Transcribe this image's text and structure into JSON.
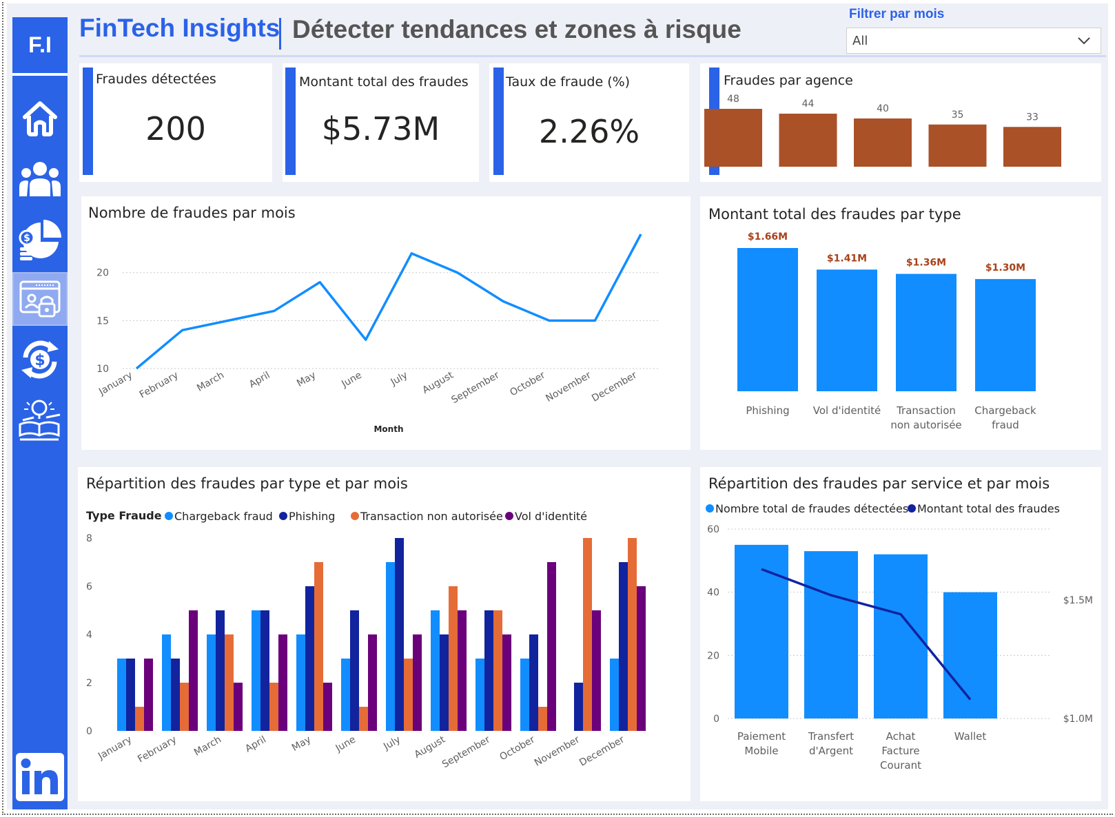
{
  "header": {
    "brand": "FinTech Insights",
    "subtitle": "Détecter tendances et zones à risque",
    "filter_label": "Filtrer par mois",
    "filter_value": "All"
  },
  "sidebar": {
    "logo": "F.I",
    "items": [
      {
        "name": "home-icon"
      },
      {
        "name": "team-icon"
      },
      {
        "name": "finance-chart-icon"
      },
      {
        "name": "fraud-security-icon",
        "active": true
      },
      {
        "name": "currency-exchange-icon"
      },
      {
        "name": "ideas-icon"
      }
    ],
    "footer_icon": "linkedin-icon"
  },
  "kpis": {
    "fraudes": {
      "label": "Fraudes détectées",
      "value": "200"
    },
    "montant": {
      "label": "Montant total des fraudes",
      "value": "$5.73M"
    },
    "taux": {
      "label": "Taux de fraude (%)",
      "value": "2.26%"
    }
  },
  "colors": {
    "accent": "#2a62e8",
    "bar_blue": "#118dff",
    "dark_blue": "#12239e",
    "orange": "#e66c37",
    "purple": "#6b007b",
    "agency_bar": "#aa5128",
    "data_label_red": "#a8421b"
  },
  "chart_data": [
    {
      "id": "agence",
      "type": "bar",
      "title": "Fraudes par agence",
      "values": [
        48,
        44,
        40,
        35,
        33
      ]
    },
    {
      "id": "mois",
      "type": "line",
      "title": "Nombre de fraudes par mois",
      "xlabel": "Month",
      "categories": [
        "January",
        "February",
        "March",
        "April",
        "May",
        "June",
        "July",
        "August",
        "September",
        "October",
        "November",
        "December"
      ],
      "values": [
        10,
        14,
        15,
        16,
        19,
        13,
        22,
        20,
        17,
        15,
        15,
        24
      ],
      "ylim": [
        10,
        24
      ],
      "yticks": [
        10,
        15,
        20
      ],
      "grid": true
    },
    {
      "id": "type",
      "type": "bar",
      "title": "Montant total des fraudes par type",
      "categories": [
        "Phishing",
        "Vol d'identité",
        "Transaction non autorisée",
        "Chargeback fraud"
      ],
      "category_lines": [
        [
          "Phishing"
        ],
        [
          "Vol d'identité"
        ],
        [
          "Transaction",
          "non autorisée"
        ],
        [
          "Chargeback",
          "fraud"
        ]
      ],
      "values": [
        1.66,
        1.41,
        1.36,
        1.3
      ],
      "data_labels": [
        "$1.66M",
        "$1.41M",
        "$1.36M",
        "$1.30M"
      ],
      "unit": "$M"
    },
    {
      "id": "type_mois",
      "type": "bar",
      "title": "Répartition des fraudes par type et par mois",
      "legend_title": "Type Fraude",
      "categories": [
        "January",
        "February",
        "March",
        "April",
        "May",
        "June",
        "July",
        "August",
        "September",
        "October",
        "November",
        "December"
      ],
      "ylim": [
        0,
        8
      ],
      "yticks": [
        0,
        2,
        4,
        6,
        8
      ],
      "grid": false,
      "series": [
        {
          "name": "Chargeback fraud",
          "color": "#118dff",
          "values": [
            3,
            4,
            4,
            5,
            4,
            3,
            7,
            5,
            3,
            3,
            0,
            3
          ]
        },
        {
          "name": "Phishing",
          "color": "#12239e",
          "values": [
            3,
            3,
            5,
            5,
            6,
            5,
            8,
            4,
            5,
            4,
            2,
            7
          ]
        },
        {
          "name": "Transaction non autorisée",
          "color": "#e66c37",
          "values": [
            1,
            2,
            4,
            2,
            7,
            1,
            3,
            6,
            5,
            1,
            8,
            8
          ]
        },
        {
          "name": "Vol d'identité",
          "color": "#6b007b",
          "values": [
            3,
            5,
            2,
            4,
            2,
            4,
            4,
            5,
            4,
            7,
            5,
            6
          ]
        }
      ]
    },
    {
      "id": "service_mois",
      "type": "bar",
      "title": "Répartition des fraudes par service et par mois",
      "categories": [
        "Paiement Mobile",
        "Transfert d'Argent",
        "Achat Facture Courant",
        "Wallet"
      ],
      "category_lines": [
        [
          "Paiement",
          "Mobile"
        ],
        [
          "Transfert",
          "d'Argent"
        ],
        [
          "Achat",
          "Facture",
          "Courant"
        ],
        [
          "Wallet"
        ]
      ],
      "series": [
        {
          "name": "Nombre total de fraudes détectées",
          "color": "#118dff",
          "values": [
            55,
            53,
            52,
            40
          ],
          "axis": "left"
        },
        {
          "name": "Montant total des fraudes",
          "color": "#12239e",
          "values": [
            1.63,
            1.52,
            1.44,
            1.08
          ],
          "axis": "right",
          "type": "line"
        }
      ],
      "ylim": [
        0,
        60
      ],
      "yticks": [
        0,
        20,
        40,
        60
      ],
      "y2ticks": [
        "$1.0M",
        "$1.5M"
      ],
      "y2lim": [
        1.0,
        1.5
      ],
      "grid": true
    }
  ]
}
